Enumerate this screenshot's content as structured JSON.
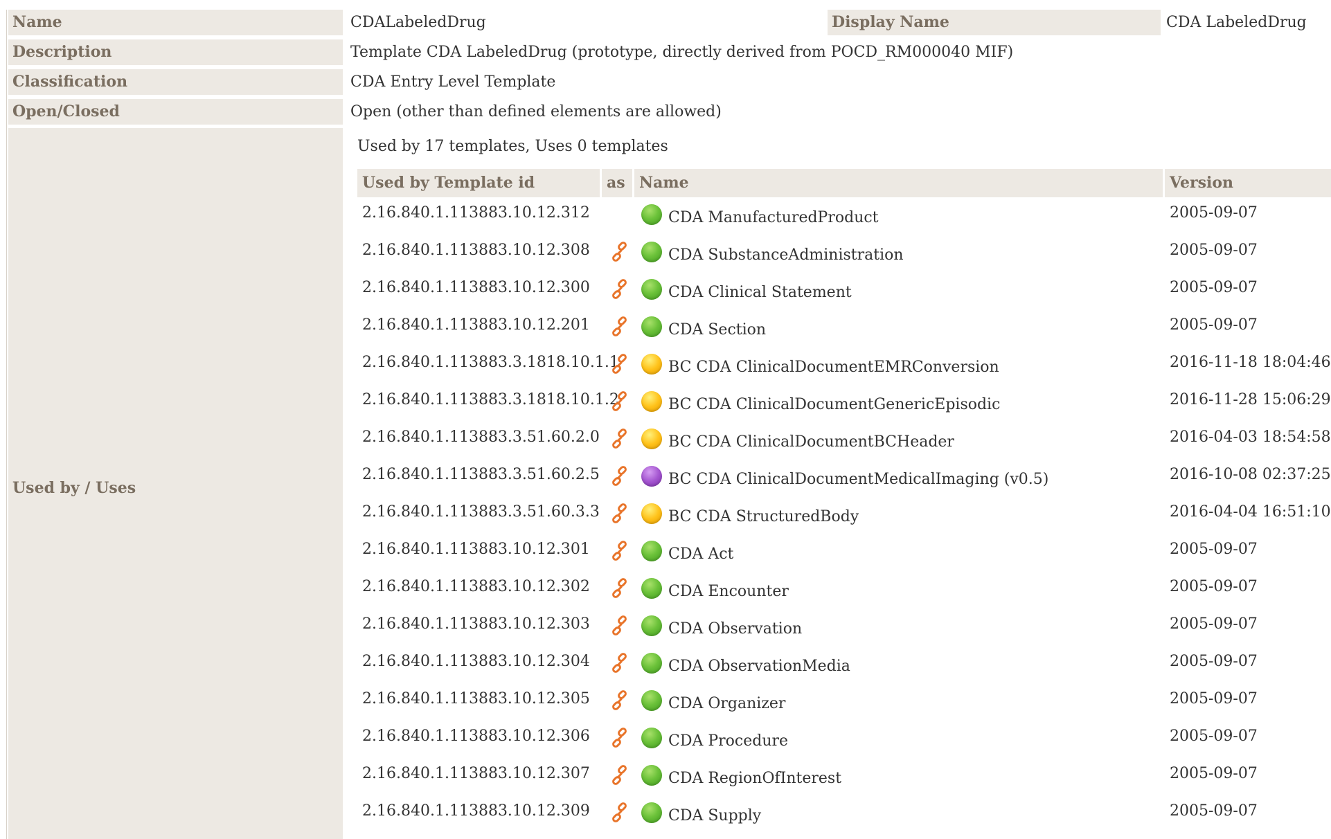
{
  "properties": {
    "name_label": "Name",
    "name_value": "CDALabeledDrug",
    "display_name_label": "Display Name",
    "display_name_value": "CDA LabeledDrug",
    "description_label": "Description",
    "description_value": "Template CDA LabeledDrug (prototype, directly derived from POCD_RM000040 MIF)",
    "classification_label": "Classification",
    "classification_value": "CDA Entry Level Template",
    "open_closed_label": "Open/Closed",
    "open_closed_value": "Open (other than defined elements are allowed)",
    "used_by_uses_label": "Used by / Uses"
  },
  "usage": {
    "summary": "Used by 17 templates, Uses 0 templates",
    "columns": {
      "id": "Used by Template id",
      "as": "as",
      "name": "Name",
      "version": "Version"
    },
    "link_icon": "link-icon",
    "status_colors": {
      "green": "#6cc23a",
      "yellow": "#ffc21a",
      "purple": "#a455d0"
    },
    "rows": [
      {
        "id": "2.16.840.1.113883.10.12.312",
        "link": false,
        "status": "green",
        "name": "CDA ManufacturedProduct",
        "version": "2005-09-07"
      },
      {
        "id": "2.16.840.1.113883.10.12.308",
        "link": true,
        "status": "green",
        "name": "CDA SubstanceAdministration",
        "version": "2005-09-07"
      },
      {
        "id": "2.16.840.1.113883.10.12.300",
        "link": true,
        "status": "green",
        "name": "CDA Clinical Statement",
        "version": "2005-09-07"
      },
      {
        "id": "2.16.840.1.113883.10.12.201",
        "link": true,
        "status": "green",
        "name": "CDA Section",
        "version": "2005-09-07"
      },
      {
        "id": "2.16.840.1.113883.3.1818.10.1.1",
        "link": true,
        "status": "yellow",
        "name": "BC CDA ClinicalDocumentEMRConversion",
        "version": "2016-11-18 18:04:46"
      },
      {
        "id": "2.16.840.1.113883.3.1818.10.1.2",
        "link": true,
        "status": "yellow",
        "name": "BC CDA ClinicalDocumentGenericEpisodic",
        "version": "2016-11-28 15:06:29"
      },
      {
        "id": "2.16.840.1.113883.3.51.60.2.0",
        "link": true,
        "status": "yellow",
        "name": "BC CDA ClinicalDocumentBCHeader",
        "version": "2016-04-03 18:54:58"
      },
      {
        "id": "2.16.840.1.113883.3.51.60.2.5",
        "link": true,
        "status": "purple",
        "name": "BC CDA ClinicalDocumentMedicalImaging (v0.5)",
        "version": "2016-10-08 02:37:25"
      },
      {
        "id": "2.16.840.1.113883.3.51.60.3.3",
        "link": true,
        "status": "yellow",
        "name": "BC CDA StructuredBody",
        "version": "2016-04-04 16:51:10"
      },
      {
        "id": "2.16.840.1.113883.10.12.301",
        "link": true,
        "status": "green",
        "name": "CDA Act",
        "version": "2005-09-07"
      },
      {
        "id": "2.16.840.1.113883.10.12.302",
        "link": true,
        "status": "green",
        "name": "CDA Encounter",
        "version": "2005-09-07"
      },
      {
        "id": "2.16.840.1.113883.10.12.303",
        "link": true,
        "status": "green",
        "name": "CDA Observation",
        "version": "2005-09-07"
      },
      {
        "id": "2.16.840.1.113883.10.12.304",
        "link": true,
        "status": "green",
        "name": "CDA ObservationMedia",
        "version": "2005-09-07"
      },
      {
        "id": "2.16.840.1.113883.10.12.305",
        "link": true,
        "status": "green",
        "name": "CDA Organizer",
        "version": "2005-09-07"
      },
      {
        "id": "2.16.840.1.113883.10.12.306",
        "link": true,
        "status": "green",
        "name": "CDA Procedure",
        "version": "2005-09-07"
      },
      {
        "id": "2.16.840.1.113883.10.12.307",
        "link": true,
        "status": "green",
        "name": "CDA RegionOfInterest",
        "version": "2005-09-07"
      },
      {
        "id": "2.16.840.1.113883.10.12.309",
        "link": true,
        "status": "green",
        "name": "CDA Supply",
        "version": "2005-09-07"
      }
    ]
  }
}
